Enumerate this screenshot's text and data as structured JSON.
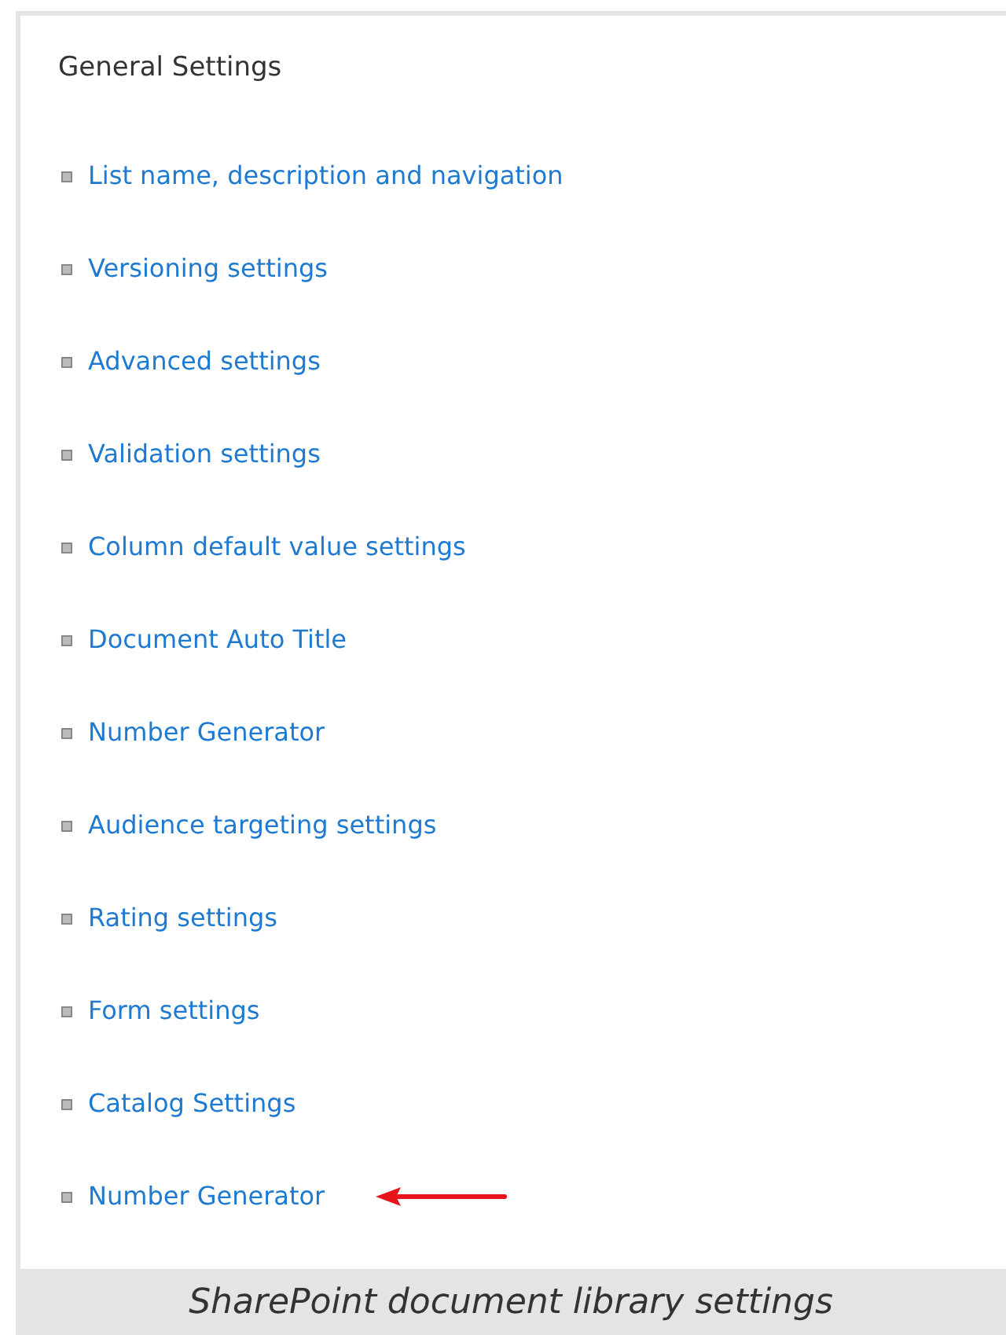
{
  "section": {
    "title": "General Settings"
  },
  "links": [
    {
      "label": "List name, description and navigation",
      "pointed": false
    },
    {
      "label": "Versioning settings",
      "pointed": false
    },
    {
      "label": "Advanced settings",
      "pointed": false
    },
    {
      "label": "Validation settings",
      "pointed": false
    },
    {
      "label": "Column default value settings",
      "pointed": false
    },
    {
      "label": "Document Auto Title",
      "pointed": false
    },
    {
      "label": "Number Generator",
      "pointed": false
    },
    {
      "label": "Audience targeting settings",
      "pointed": false
    },
    {
      "label": "Rating settings",
      "pointed": false
    },
    {
      "label": "Form settings",
      "pointed": false
    },
    {
      "label": "Catalog Settings",
      "pointed": false
    },
    {
      "label": "Number Generator",
      "pointed": true
    }
  ],
  "caption": "SharePoint document library settings"
}
